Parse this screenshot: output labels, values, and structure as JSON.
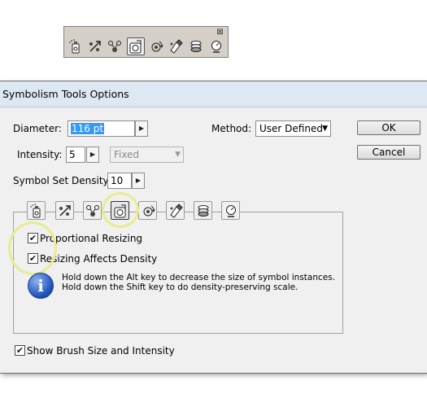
{
  "toolbar": {
    "close_glyph": "⊠",
    "icons": [
      "symbol-sprayer-icon",
      "symbol-shifter-icon",
      "symbol-scruncher-icon",
      "symbol-sizer-icon",
      "symbol-spinner-icon",
      "symbol-stainer-icon",
      "symbol-screener-icon",
      "symbol-styler-icon"
    ],
    "active_index": 3
  },
  "dialog": {
    "title": "Symbolism Tools Options",
    "diameter_label": "Diameter:",
    "diameter_value": "116 pt",
    "method_label": "Method:",
    "method_value": "User Defined",
    "intensity_label": "Intensity:",
    "intensity_value": "5",
    "intensity_mode": "Fixed",
    "density_label": "Symbol Set Density:",
    "density_value": "10",
    "ok_label": "OK",
    "cancel_label": "Cancel",
    "proportional_label": "Proportional Resizing",
    "proportional_checked": true,
    "affects_density_label": "Resizing Affects Density",
    "affects_density_checked": true,
    "info_glyph": "i",
    "hint_line1": "Hold down the Alt key to decrease the size of symbol instances.",
    "hint_line2": "Hold down the Shift key to do density-preserving scale.",
    "show_brush_label": "Show Brush Size and Intensity",
    "show_brush_checked": true
  },
  "colors": {
    "highlight_ring": "#e8ec8e",
    "selection": "#3399ff",
    "info_blue": "#1c4db7"
  }
}
